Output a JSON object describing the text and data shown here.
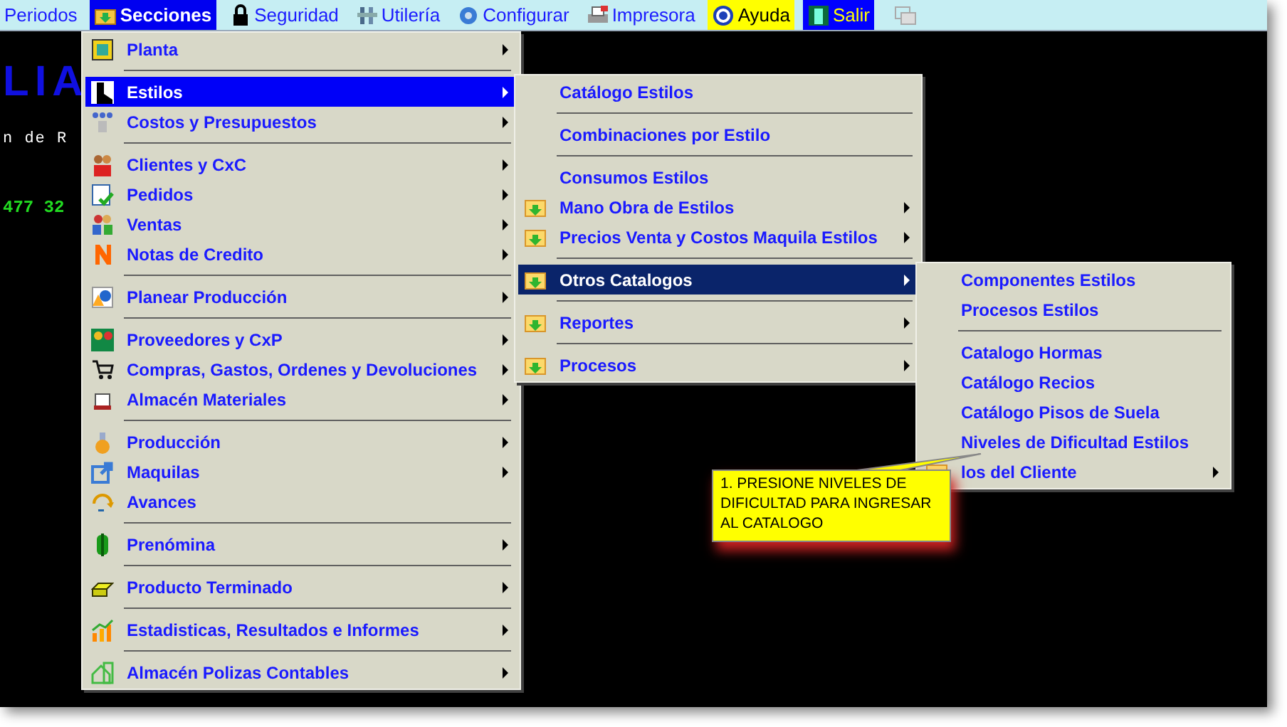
{
  "background": {
    "banner": "LIA",
    "subtitle": "n de R",
    "phone": "477 32"
  },
  "menubar": [
    {
      "label": "Periodos",
      "selected": false
    },
    {
      "label": "Secciones",
      "selected": true
    },
    {
      "label": "Seguridad",
      "selected": false
    },
    {
      "label": "Utilería",
      "selected": false
    },
    {
      "label": "Configurar",
      "selected": false
    },
    {
      "label": "Impresora",
      "selected": false
    },
    {
      "label": "Ayuda",
      "selected": false,
      "color": "#ffff00"
    },
    {
      "label": "Salir",
      "selected": false,
      "color": "#0000ff"
    }
  ],
  "sections_menu": [
    {
      "kind": "item",
      "label": "Planta",
      "submenu": true,
      "selected": false
    },
    {
      "kind": "separator"
    },
    {
      "kind": "item",
      "label": "Estilos",
      "submenu": true,
      "selected": true
    },
    {
      "kind": "item",
      "label": "Costos y Presupuestos",
      "submenu": true,
      "selected": false
    },
    {
      "kind": "separator"
    },
    {
      "kind": "item",
      "label": "Clientes y CxC",
      "submenu": true,
      "selected": false
    },
    {
      "kind": "item",
      "label": "Pedidos",
      "submenu": true,
      "selected": false
    },
    {
      "kind": "item",
      "label": "Ventas",
      "submenu": true,
      "selected": false
    },
    {
      "kind": "item",
      "label": "Notas de Credito",
      "submenu": true,
      "selected": false
    },
    {
      "kind": "separator"
    },
    {
      "kind": "item",
      "label": "Planear Producción",
      "submenu": true,
      "selected": false
    },
    {
      "kind": "separator"
    },
    {
      "kind": "item",
      "label": "Proveedores y CxP",
      "submenu": true,
      "selected": false
    },
    {
      "kind": "item",
      "label": "Compras, Gastos, Ordenes y Devoluciones",
      "submenu": true,
      "selected": false
    },
    {
      "kind": "item",
      "label": "Almacén Materiales",
      "submenu": true,
      "selected": false
    },
    {
      "kind": "separator"
    },
    {
      "kind": "item",
      "label": "Producción",
      "submenu": true,
      "selected": false
    },
    {
      "kind": "item",
      "label": "Maquilas",
      "submenu": true,
      "selected": false
    },
    {
      "kind": "item",
      "label": "Avances",
      "submenu": false,
      "selected": false
    },
    {
      "kind": "separator"
    },
    {
      "kind": "item",
      "label": "Prenómina",
      "submenu": true,
      "selected": false
    },
    {
      "kind": "separator"
    },
    {
      "kind": "item",
      "label": "Producto Terminado",
      "submenu": true,
      "selected": false
    },
    {
      "kind": "separator"
    },
    {
      "kind": "item",
      "label": "Estadisticas, Resultados e Informes",
      "submenu": true,
      "selected": false
    },
    {
      "kind": "separator"
    },
    {
      "kind": "item",
      "label": "Almacén Polizas Contables",
      "submenu": true,
      "selected": false
    }
  ],
  "styles_menu": [
    {
      "kind": "item",
      "label": "Catálogo Estilos",
      "submenu": false,
      "selected": false,
      "folder": false
    },
    {
      "kind": "separator"
    },
    {
      "kind": "item",
      "label": "Combinaciones por Estilo",
      "submenu": false,
      "selected": false,
      "folder": false
    },
    {
      "kind": "separator"
    },
    {
      "kind": "item",
      "label": "Consumos Estilos",
      "submenu": false,
      "selected": false,
      "folder": false
    },
    {
      "kind": "item",
      "label": "Mano Obra de Estilos",
      "submenu": true,
      "selected": false,
      "folder": true
    },
    {
      "kind": "item",
      "label": "Precios Venta y Costos Maquila Estilos",
      "submenu": true,
      "selected": false,
      "folder": true
    },
    {
      "kind": "separator"
    },
    {
      "kind": "item",
      "label": "Otros Catalogos",
      "submenu": true,
      "selected": true,
      "folder": true
    },
    {
      "kind": "separator"
    },
    {
      "kind": "item",
      "label": "Reportes",
      "submenu": true,
      "selected": false,
      "folder": true
    },
    {
      "kind": "separator"
    },
    {
      "kind": "item",
      "label": "Procesos",
      "submenu": true,
      "selected": false,
      "folder": true
    }
  ],
  "other_catalogs_menu": [
    {
      "kind": "item",
      "label": "Componentes Estilos",
      "submenu": false,
      "selected": false,
      "folder": false
    },
    {
      "kind": "item",
      "label": "Procesos Estilos",
      "submenu": false,
      "selected": false,
      "folder": false
    },
    {
      "kind": "separator"
    },
    {
      "kind": "item",
      "label": "Catalogo Hormas",
      "submenu": false,
      "selected": false,
      "folder": false
    },
    {
      "kind": "item",
      "label": "Catálogo Recios",
      "submenu": false,
      "selected": false,
      "folder": false
    },
    {
      "kind": "item",
      "label": "Catálogo Pisos de Suela",
      "submenu": false,
      "selected": false,
      "folder": false
    },
    {
      "kind": "item",
      "label": "Niveles de Dificultad Estilos",
      "submenu": false,
      "selected": false,
      "folder": false
    },
    {
      "kind": "item",
      "label": "los del Cliente",
      "submenu": true,
      "selected": false,
      "folder": true
    }
  ],
  "callout": {
    "text": "1. PRESIONE NIVELES DE DIFICULTAD PARA INGRESAR AL CATALOGO"
  }
}
